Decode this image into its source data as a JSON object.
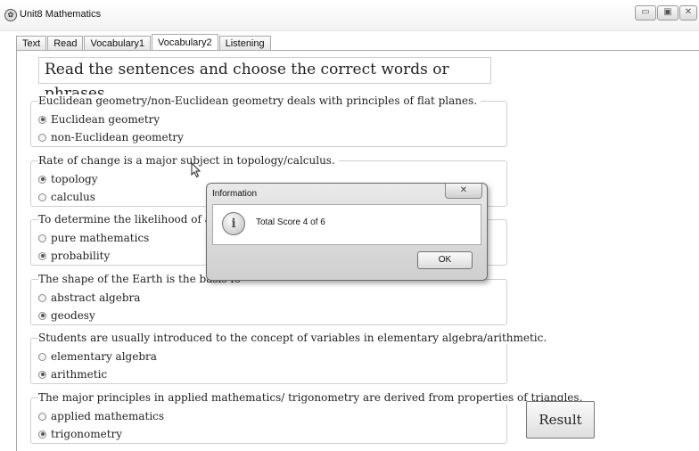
{
  "window": {
    "title": "Unit8 Mathematics",
    "controls": {
      "minimize": "▭",
      "maximize": "▣",
      "close": "✕"
    }
  },
  "tabs": [
    {
      "label": "Text",
      "active": false
    },
    {
      "label": "Read",
      "active": false
    },
    {
      "label": "Vocabulary1",
      "active": false
    },
    {
      "label": "Vocabulary2",
      "active": true
    },
    {
      "label": "Listening",
      "active": false
    }
  ],
  "instruction": "Read the sentences and choose the correct words or phrases.",
  "questions": [
    {
      "text": "Euclidean geometry/non-Euclidean geometry deals with principles of flat planes.",
      "options": [
        {
          "label": "Euclidean geometry",
          "selected": true
        },
        {
          "label": "non-Euclidean geometry",
          "selected": false
        }
      ]
    },
    {
      "text": "Rate of change is a major subject in topology/calculus.",
      "options": [
        {
          "label": "topology",
          "selected": true
        },
        {
          "label": "calculus",
          "selected": false
        }
      ]
    },
    {
      "text": "To determine the likelihood of an eve",
      "options": [
        {
          "label": "pure mathematics",
          "selected": false
        },
        {
          "label": "probability",
          "selected": true
        }
      ]
    },
    {
      "text": "The shape of the Earth is the basis fo",
      "options": [
        {
          "label": "abstract algebra",
          "selected": false
        },
        {
          "label": "geodesy",
          "selected": true
        }
      ]
    },
    {
      "text": "Students are usually introduced to the concept of variables in elementary algebra/arithmetic.",
      "options": [
        {
          "label": "elementary algebra",
          "selected": false
        },
        {
          "label": "arithmetic",
          "selected": true
        }
      ]
    },
    {
      "text": "The major principles in applied mathematics/ trigonometry are derived from properties of triangles.",
      "options": [
        {
          "label": "applied mathematics",
          "selected": false
        },
        {
          "label": "trigonometry",
          "selected": true
        }
      ]
    }
  ],
  "result_button": "Result",
  "dialog": {
    "title": "Information",
    "close": "✕",
    "message": "Total Score  4  of 6",
    "ok": "OK"
  }
}
